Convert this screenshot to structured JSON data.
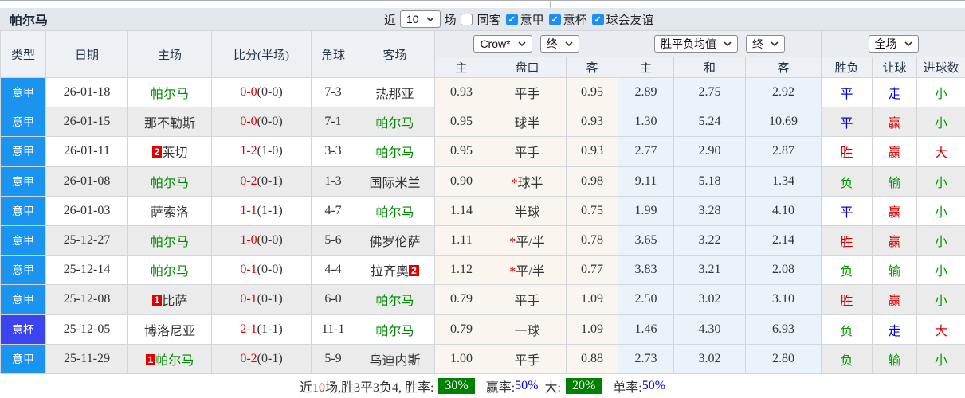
{
  "title": "帕尔马",
  "colors": {
    "league_badge": "#1B94F0",
    "cup_badge": "#3C44EF",
    "team_green": "#008800",
    "score_red": "#E00000",
    "win_red": "#D40000",
    "draw_blue": "#0000DD",
    "lose_green": "#009900",
    "rate_badge_bg": "#008000",
    "rate_value_blue": "#0000EE",
    "checkbox_blue": "#1E8FF0"
  },
  "controls": {
    "recent_label": "近",
    "recent_value": "10",
    "unit_label": "场",
    "checkboxes": [
      {
        "label": "同客",
        "checked": false
      },
      {
        "label": "意甲",
        "checked": true
      },
      {
        "label": "意杯",
        "checked": true
      },
      {
        "label": "球会友谊",
        "checked": true
      }
    ]
  },
  "table": {
    "headers": [
      "类型",
      "日期",
      "主场",
      "比分(半场)",
      "角球",
      "客场"
    ],
    "selects": {
      "company": "Crow*",
      "company_time": "终",
      "avg": "胜平负均值",
      "avg_time": "终",
      "full": "全场"
    },
    "subheaders": [
      "主",
      "盘口",
      "客",
      "主",
      "和",
      "客",
      "胜负",
      "让球",
      "进球数"
    ]
  },
  "rows": [
    {
      "league": "意甲",
      "cup": false,
      "date": "26-01-18",
      "home": {
        "name": "帕尔马",
        "green": true
      },
      "score": "0-0",
      "half": "(0-0)",
      "corner": "7-3",
      "away": {
        "name": "热那亚",
        "green": false
      },
      "crow": [
        "0.93",
        "平手",
        "0.95"
      ],
      "star": false,
      "avg": [
        "2.89",
        "2.75",
        "2.92"
      ],
      "res": [
        [
          "平",
          "b"
        ],
        [
          "走",
          "b"
        ],
        [
          "小",
          "g"
        ]
      ]
    },
    {
      "league": "意甲",
      "cup": false,
      "date": "26-01-15",
      "home": {
        "name": "那不勒斯",
        "green": false
      },
      "score": "0-0",
      "half": "(0-0)",
      "corner": "7-1",
      "away": {
        "name": "帕尔马",
        "green": true
      },
      "crow": [
        "0.95",
        "球半",
        "0.93"
      ],
      "star": false,
      "avg": [
        "1.30",
        "5.24",
        "10.69"
      ],
      "res": [
        [
          "平",
          "b"
        ],
        [
          "赢",
          "r"
        ],
        [
          "小",
          "g"
        ]
      ]
    },
    {
      "league": "意甲",
      "cup": false,
      "date": "26-01-11",
      "home": {
        "name": "莱切",
        "green": false,
        "badge": "2",
        "badge_pos": "before"
      },
      "score": "1-2",
      "half": "(1-0)",
      "corner": "3-3",
      "away": {
        "name": "帕尔马",
        "green": true
      },
      "crow": [
        "0.95",
        "平手",
        "0.93"
      ],
      "star": false,
      "avg": [
        "2.77",
        "2.90",
        "2.87"
      ],
      "res": [
        [
          "胜",
          "r"
        ],
        [
          "赢",
          "r"
        ],
        [
          "大",
          "r"
        ]
      ]
    },
    {
      "league": "意甲",
      "cup": false,
      "date": "26-01-08",
      "home": {
        "name": "帕尔马",
        "green": true
      },
      "score": "0-2",
      "half": "(0-1)",
      "corner": "1-3",
      "away": {
        "name": "国际米兰",
        "green": false
      },
      "crow": [
        "0.90",
        "球半",
        "0.98"
      ],
      "star": true,
      "avg": [
        "9.11",
        "5.18",
        "1.34"
      ],
      "res": [
        [
          "负",
          "g"
        ],
        [
          "输",
          "g"
        ],
        [
          "小",
          "g"
        ]
      ]
    },
    {
      "league": "意甲",
      "cup": false,
      "date": "26-01-03",
      "home": {
        "name": "萨索洛",
        "green": false
      },
      "score": "1-1",
      "half": "(1-1)",
      "corner": "4-7",
      "away": {
        "name": "帕尔马",
        "green": true
      },
      "crow": [
        "1.14",
        "半球",
        "0.75"
      ],
      "star": false,
      "avg": [
        "1.99",
        "3.28",
        "4.10"
      ],
      "res": [
        [
          "平",
          "b"
        ],
        [
          "赢",
          "r"
        ],
        [
          "小",
          "g"
        ]
      ]
    },
    {
      "league": "意甲",
      "cup": false,
      "date": "25-12-27",
      "home": {
        "name": "帕尔马",
        "green": true
      },
      "score": "1-0",
      "half": "(0-0)",
      "corner": "5-6",
      "away": {
        "name": "佛罗伦萨",
        "green": false
      },
      "crow": [
        "1.11",
        "平/半",
        "0.78"
      ],
      "star": true,
      "avg": [
        "3.65",
        "3.22",
        "2.14"
      ],
      "res": [
        [
          "胜",
          "r"
        ],
        [
          "赢",
          "r"
        ],
        [
          "小",
          "g"
        ]
      ]
    },
    {
      "league": "意甲",
      "cup": false,
      "date": "25-12-14",
      "home": {
        "name": "帕尔马",
        "green": true
      },
      "score": "0-1",
      "half": "(0-0)",
      "corner": "4-4",
      "away": {
        "name": "拉齐奥",
        "green": false,
        "badge": "2",
        "badge_pos": "after"
      },
      "crow": [
        "1.12",
        "平/半",
        "0.77"
      ],
      "star": true,
      "avg": [
        "3.83",
        "3.21",
        "2.08"
      ],
      "res": [
        [
          "负",
          "g"
        ],
        [
          "输",
          "g"
        ],
        [
          "小",
          "g"
        ]
      ]
    },
    {
      "league": "意甲",
      "cup": false,
      "date": "25-12-08",
      "home": {
        "name": "比萨",
        "green": false,
        "badge": "1",
        "badge_pos": "before"
      },
      "score": "0-1",
      "half": "(0-1)",
      "corner": "6-0",
      "away": {
        "name": "帕尔马",
        "green": true
      },
      "crow": [
        "0.79",
        "平手",
        "1.09"
      ],
      "star": false,
      "avg": [
        "2.50",
        "3.02",
        "3.10"
      ],
      "res": [
        [
          "胜",
          "r"
        ],
        [
          "赢",
          "r"
        ],
        [
          "小",
          "g"
        ]
      ]
    },
    {
      "league": "意杯",
      "cup": true,
      "date": "25-12-05",
      "home": {
        "name": "博洛尼亚",
        "green": false
      },
      "score": "2-1",
      "half": "(1-1)",
      "corner": "11-1",
      "away": {
        "name": "帕尔马",
        "green": true
      },
      "crow": [
        "0.79",
        "一球",
        "1.09"
      ],
      "star": false,
      "avg": [
        "1.46",
        "4.30",
        "6.93"
      ],
      "res": [
        [
          "负",
          "g"
        ],
        [
          "走",
          "b"
        ],
        [
          "大",
          "r"
        ]
      ]
    },
    {
      "league": "意甲",
      "cup": false,
      "date": "25-11-29",
      "home": {
        "name": "帕尔马",
        "green": true,
        "badge": "1",
        "badge_pos": "before"
      },
      "score": "0-2",
      "half": "(0-1)",
      "corner": "5-9",
      "away": {
        "name": "乌迪内斯",
        "green": false
      },
      "crow": [
        "1.00",
        "平手",
        "0.88"
      ],
      "star": false,
      "avg": [
        "2.73",
        "3.02",
        "2.80"
      ],
      "res": [
        [
          "负",
          "g"
        ],
        [
          "输",
          "g"
        ],
        [
          "小",
          "g"
        ]
      ]
    }
  ],
  "footer": {
    "p1": "近",
    "recent": "10",
    "p2": "场,胜3平3负4, 胜率:",
    "win_rate": "30%",
    "m1": "赢率:",
    "win_pct": "50%",
    "m2": "大:",
    "big_rate": "20%",
    "m3": "单率:",
    "single_pct": "50%"
  }
}
